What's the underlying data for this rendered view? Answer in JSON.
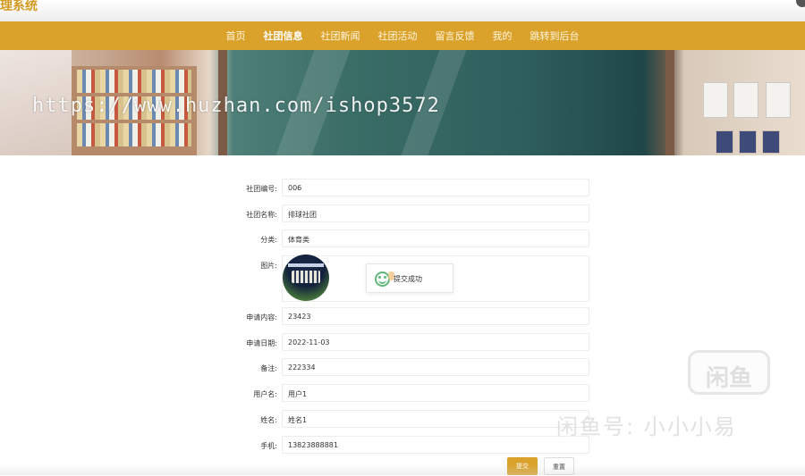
{
  "header": {
    "site_title": "理系统"
  },
  "nav": {
    "items": [
      {
        "label": "首页",
        "active": false
      },
      {
        "label": "社团信息",
        "active": true
      },
      {
        "label": "社团新闻",
        "active": false
      },
      {
        "label": "社团活动",
        "active": false
      },
      {
        "label": "留言反馈",
        "active": false
      },
      {
        "label": "我的",
        "active": false
      },
      {
        "label": "跳转到后台",
        "active": false
      }
    ]
  },
  "banner": {
    "watermark": "https://www.huzhan.com/ishop3572"
  },
  "form": {
    "fields": [
      {
        "label": "社团编号:",
        "value": "006"
      },
      {
        "label": "社团名称:",
        "value": "排球社团"
      },
      {
        "label": "分类:",
        "value": "体育类"
      },
      {
        "label": "图片:",
        "value": ""
      },
      {
        "label": "申请内容:",
        "value": "23423"
      },
      {
        "label": "申请日期:",
        "value": "2022-11-03"
      },
      {
        "label": "备注:",
        "value": "222334"
      },
      {
        "label": "用户名:",
        "value": "用户1"
      },
      {
        "label": "姓名:",
        "value": "姓名1"
      },
      {
        "label": "手机:",
        "value": "13823888881"
      }
    ],
    "submit_label": "提交",
    "reset_label": "重置"
  },
  "toast": {
    "message": "提交成功",
    "icon": "smile-icon"
  },
  "overlay": {
    "logo_text": "闲鱼",
    "caption": "闲鱼号: 小小小易"
  },
  "colors": {
    "accent": "#daa22a",
    "success": "#5fb878"
  }
}
